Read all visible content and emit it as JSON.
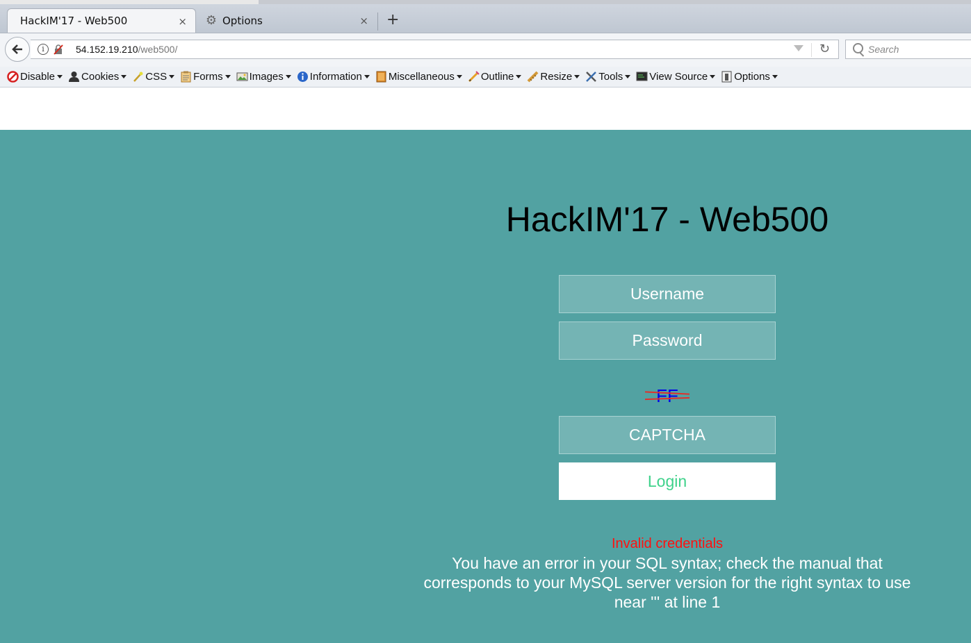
{
  "browser": {
    "tabs": [
      {
        "title": "HackIM'17 - Web500",
        "active": true
      },
      {
        "title": "Options",
        "active": false
      }
    ],
    "close_glyph": "×",
    "new_tab_glyph": "+",
    "url_host": "54.152.19.210",
    "url_path": "/web500/",
    "search_placeholder": "Search"
  },
  "devtoolbar": {
    "items": [
      {
        "label": "Disable",
        "icon": "disable-icon"
      },
      {
        "label": "Cookies",
        "icon": "cookies-icon"
      },
      {
        "label": "CSS",
        "icon": "css-icon"
      },
      {
        "label": "Forms",
        "icon": "forms-icon"
      },
      {
        "label": "Images",
        "icon": "images-icon"
      },
      {
        "label": "Information",
        "icon": "information-icon"
      },
      {
        "label": "Miscellaneous",
        "icon": "miscellaneous-icon"
      },
      {
        "label": "Outline",
        "icon": "outline-icon"
      },
      {
        "label": "Resize",
        "icon": "resize-icon"
      },
      {
        "label": "Tools",
        "icon": "tools-icon"
      },
      {
        "label": "View Source",
        "icon": "view-source-icon"
      },
      {
        "label": "Options",
        "icon": "options-icon"
      }
    ]
  },
  "page": {
    "title": "HackIM'17 - Web500",
    "username_placeholder": "Username",
    "password_placeholder": "Password",
    "captcha_text": "FF",
    "captcha_placeholder": "CAPTCHA",
    "login_label": "Login",
    "error_title": "Invalid credentials",
    "error_message": "You have an error in your SQL syntax; check the manual that corresponds to your MySQL server version for the right syntax to use near ''' at line 1"
  },
  "colors": {
    "page_background": "#52a2a2",
    "field_background": "#74b4b4",
    "login_text": "#3fd28b",
    "error_title": "#ff1010"
  }
}
